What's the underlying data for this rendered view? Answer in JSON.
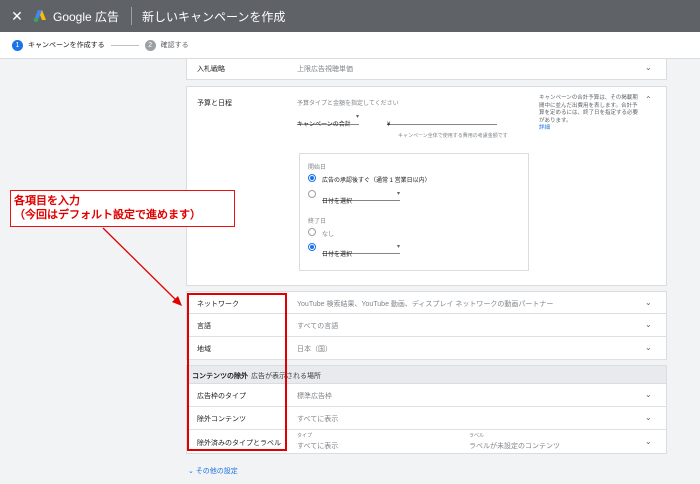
{
  "topbar": {
    "close": "✕",
    "brand": "Google 広告",
    "title": "新しいキャンペーンを作成"
  },
  "stepper": {
    "steps": [
      {
        "num": "1",
        "label": "キャンペーンを作成する"
      },
      {
        "num": "2",
        "label": "確認する"
      }
    ]
  },
  "bidding": {
    "label": "入札戦略",
    "value": "上限広告視聴単価"
  },
  "budget": {
    "label": "予算と日程",
    "instruction": "予算タイプと金額を指定してください",
    "budget_type": "キャンペーンの合計",
    "currency": "¥",
    "hint": "キャンペーン全体で使用する費用の考慮金額です",
    "help_text": "キャンペーンの合計予算は、その掲載期間中に並んだ出費用を表します。合計予算を定めるには、終了日を指定する必要があります。",
    "help_link": "詳細",
    "start_label": "開始日",
    "start_options": [
      "広告の承認後すぐ（通常 1 営業日以内）",
      "日付を選択"
    ],
    "end_label": "終了日",
    "end_options": [
      "なし",
      "日付を選択"
    ]
  },
  "rows": {
    "network": {
      "label": "ネットワーク",
      "value": "YouTube 検索結果、YouTube 動画、ディスプレイ ネットワークの動画パートナー"
    },
    "language": {
      "label": "言語",
      "value": "すべての言語"
    },
    "location": {
      "label": "地域",
      "value": "日本（国）"
    }
  },
  "exclusions": {
    "header_bold": "コンテンツの除外",
    "header_rest": "広告が表示される場所",
    "inventory": {
      "label": "広告枠のタイプ",
      "value": "標準広告枠"
    },
    "excluded_content": {
      "label": "除外コンテンツ",
      "value": "すべてに表示"
    },
    "types_labels": {
      "label": "除外済みのタイプとラベル",
      "type_caption": "タイプ",
      "type_value": "すべてに表示",
      "label_caption": "ラベル",
      "label_value": "ラベルが未設定のコンテンツ"
    }
  },
  "other_settings": "その他の設定",
  "annotation": {
    "line1": "各項目を入力",
    "line2": "（今回はデフォルト設定で進めます）"
  },
  "colors": {
    "accent": "#1a73e8",
    "annotation": "#e00000",
    "topbar": "#5f6368"
  }
}
